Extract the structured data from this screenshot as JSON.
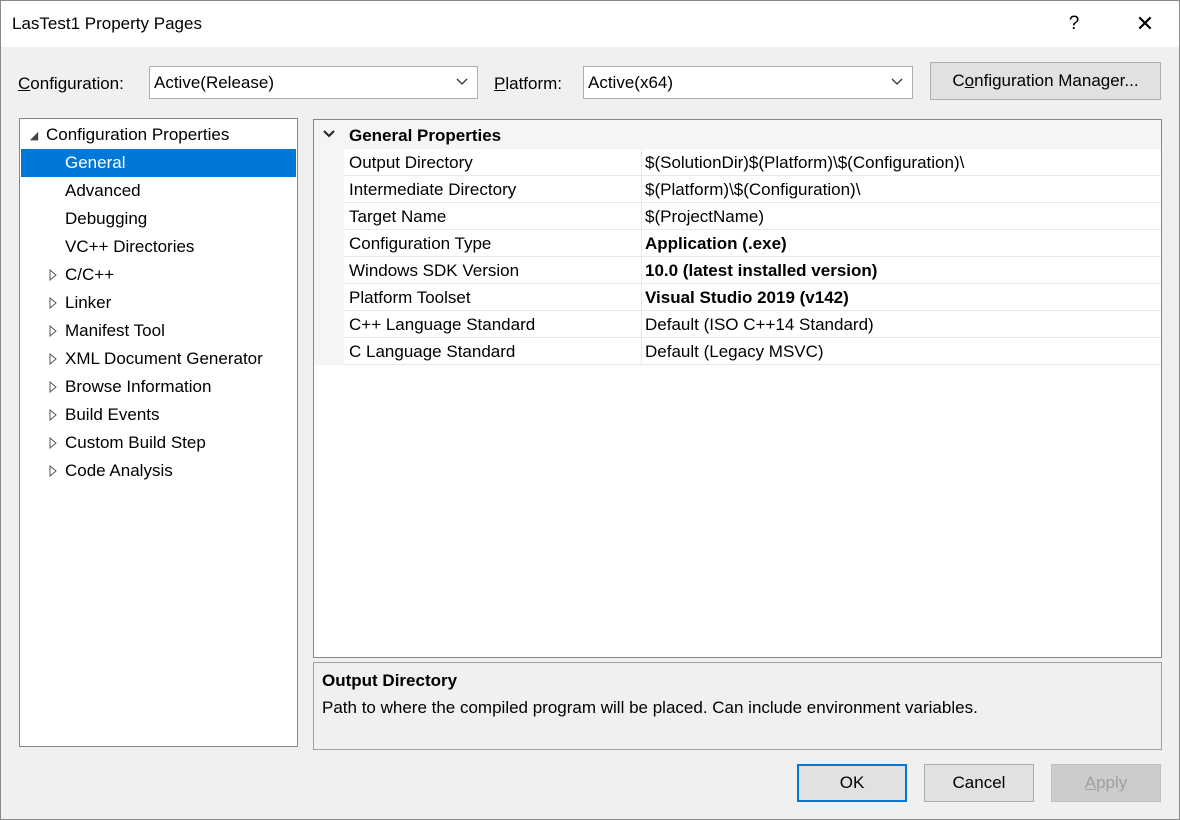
{
  "window": {
    "title": "LasTest1 Property Pages",
    "help_glyph": "?",
    "close_glyph": "✕"
  },
  "toolbar": {
    "configuration_label": "Configuration:",
    "configuration_value": "Active(Release)",
    "platform_label": "Platform:",
    "platform_value": "Active(x64)",
    "config_manager_label": "Configuration Manager..."
  },
  "tree": {
    "root": "Configuration Properties",
    "items": [
      {
        "label": "General",
        "expandable": false,
        "selected": true
      },
      {
        "label": "Advanced",
        "expandable": false
      },
      {
        "label": "Debugging",
        "expandable": false
      },
      {
        "label": "VC++ Directories",
        "expandable": false
      },
      {
        "label": "C/C++",
        "expandable": true
      },
      {
        "label": "Linker",
        "expandable": true
      },
      {
        "label": "Manifest Tool",
        "expandable": true
      },
      {
        "label": "XML Document Generator",
        "expandable": true
      },
      {
        "label": "Browse Information",
        "expandable": true
      },
      {
        "label": "Build Events",
        "expandable": true
      },
      {
        "label": "Custom Build Step",
        "expandable": true
      },
      {
        "label": "Code Analysis",
        "expandable": true
      }
    ]
  },
  "grid": {
    "category": "General Properties",
    "rows": [
      {
        "name": "Output Directory",
        "value": "$(SolutionDir)$(Platform)\\$(Configuration)\\",
        "bold": false
      },
      {
        "name": "Intermediate Directory",
        "value": "$(Platform)\\$(Configuration)\\",
        "bold": false
      },
      {
        "name": "Target Name",
        "value": "$(ProjectName)",
        "bold": false
      },
      {
        "name": "Configuration Type",
        "value": "Application (.exe)",
        "bold": true
      },
      {
        "name": "Windows SDK Version",
        "value": "10.0 (latest installed version)",
        "bold": true
      },
      {
        "name": "Platform Toolset",
        "value": "Visual Studio 2019 (v142)",
        "bold": true
      },
      {
        "name": "C++ Language Standard",
        "value": "Default (ISO C++14 Standard)",
        "bold": false
      },
      {
        "name": "C Language Standard",
        "value": "Default (Legacy MSVC)",
        "bold": false
      }
    ]
  },
  "description": {
    "title": "Output Directory",
    "text": "Path to where the compiled program will be placed. Can include environment variables."
  },
  "buttons": {
    "ok": "OK",
    "cancel": "Cancel",
    "apply": "Apply"
  },
  "colors": {
    "accent": "#0078d7"
  }
}
